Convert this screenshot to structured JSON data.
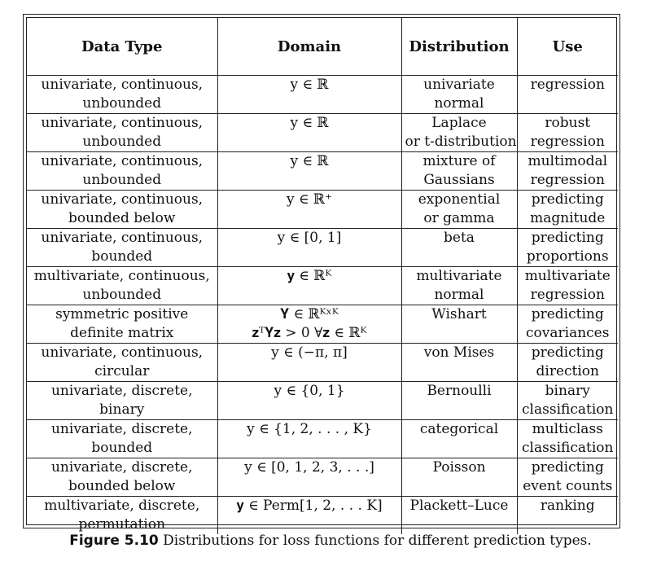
{
  "headers": [
    "Data Type",
    "Domain",
    "Distribution",
    "Use"
  ],
  "rows": [
    {
      "type": [
        "univariate, continuous,",
        "unbounded"
      ],
      "domain": [
        "y ∈ ℝ"
      ],
      "dist": [
        "univariate",
        "normal"
      ],
      "use": [
        "regression"
      ]
    },
    {
      "type": [
        "univariate, continuous,",
        "unbounded"
      ],
      "domain": [
        "y ∈ ℝ"
      ],
      "dist": [
        "Laplace",
        "or t-distribution"
      ],
      "use": [
        "robust",
        "regression"
      ]
    },
    {
      "type": [
        "univariate, continuous,",
        "unbounded"
      ],
      "domain": [
        "y ∈ ℝ"
      ],
      "dist": [
        "mixture of",
        "Gaussians"
      ],
      "use": [
        "multimodal",
        "regression"
      ]
    },
    {
      "type": [
        "univariate, continuous,",
        "bounded below"
      ],
      "domain": [
        "y ∈ ℝ⁺"
      ],
      "dist": [
        "exponential",
        "or gamma"
      ],
      "use": [
        "predicting",
        "magnitude"
      ]
    },
    {
      "type": [
        "univariate, continuous,",
        "bounded"
      ],
      "domain": [
        "y ∈ [0, 1]"
      ],
      "dist": [
        "beta"
      ],
      "use": [
        "predicting",
        "proportions"
      ]
    },
    {
      "type": [
        "multivariate, continuous,",
        "unbounded"
      ],
      "domain": [
        "𝐲 ∈ ℝᴷ"
      ],
      "dist": [
        "multivariate",
        "normal"
      ],
      "use": [
        "multivariate",
        "regression"
      ]
    },
    {
      "type": [
        "symmetric positive",
        "definite matrix"
      ],
      "domain": [
        "𝐘 ∈ ℝᴷˣᴷ",
        "𝐳ᵀ𝐘𝐳 > 0   ∀𝐳 ∈ ℝᴷ"
      ],
      "dist": [
        "Wishart"
      ],
      "use": [
        "predicting",
        "covariances"
      ]
    },
    {
      "type": [
        "univariate, continuous,",
        "circular"
      ],
      "domain": [
        "y ∈ (−π, π]"
      ],
      "dist": [
        "von Mises"
      ],
      "use": [
        "predicting",
        "direction"
      ]
    },
    {
      "type": [
        "univariate, discrete,",
        "binary"
      ],
      "domain": [
        "y ∈ {0, 1}"
      ],
      "dist": [
        "Bernoulli"
      ],
      "use": [
        "binary",
        "classification"
      ]
    },
    {
      "type": [
        "univariate, discrete,",
        "bounded"
      ],
      "domain": [
        "y ∈ {1, 2, . . . , K}"
      ],
      "dist": [
        "categorical"
      ],
      "use": [
        "multiclass",
        "classification"
      ]
    },
    {
      "type": [
        "univariate, discrete,",
        "bounded below"
      ],
      "domain": [
        "y ∈ [0, 1, 2, 3, . . .]"
      ],
      "dist": [
        "Poisson"
      ],
      "use": [
        "predicting",
        "event counts"
      ]
    },
    {
      "type": [
        "multivariate, discrete,",
        "permutation"
      ],
      "domain": [
        "𝐲 ∈ Perm[1, 2, . . . K]"
      ],
      "dist": [
        "Plackett–Luce"
      ],
      "use": [
        "ranking"
      ]
    }
  ],
  "caption": {
    "label": "Figure 5.10",
    "text": " Distributions for loss functions for different prediction types."
  }
}
